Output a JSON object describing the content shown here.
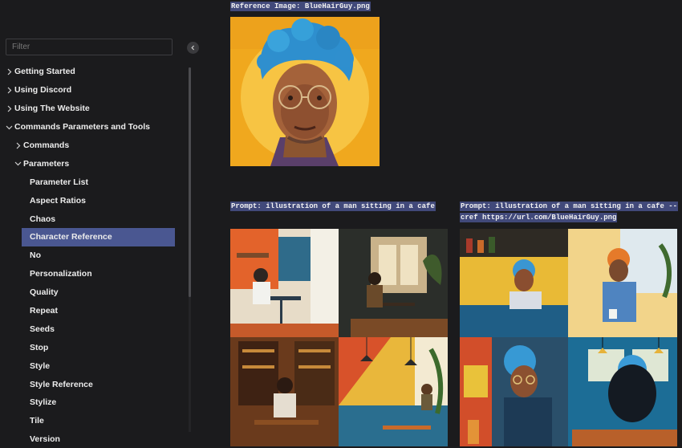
{
  "sidebar": {
    "filter_placeholder": "Filter",
    "items": [
      {
        "label": "Getting Started",
        "level": 0,
        "chevron": "right"
      },
      {
        "label": "Using Discord",
        "level": 0,
        "chevron": "right"
      },
      {
        "label": "Using The Website",
        "level": 0,
        "chevron": "right"
      },
      {
        "label": "Commands Parameters and Tools",
        "level": 0,
        "chevron": "down"
      },
      {
        "label": "Commands",
        "level": 1,
        "chevron": "right"
      },
      {
        "label": "Parameters",
        "level": 1,
        "chevron": "down"
      },
      {
        "label": "Parameter List",
        "level": 2
      },
      {
        "label": "Aspect Ratios",
        "level": 2
      },
      {
        "label": "Chaos",
        "level": 2
      },
      {
        "label": "Character Reference",
        "level": 2,
        "active": true
      },
      {
        "label": "No",
        "level": 2
      },
      {
        "label": "Personalization",
        "level": 2
      },
      {
        "label": "Quality",
        "level": 2
      },
      {
        "label": "Repeat",
        "level": 2
      },
      {
        "label": "Seeds",
        "level": 2
      },
      {
        "label": "Stop",
        "level": 2
      },
      {
        "label": "Style",
        "level": 2
      },
      {
        "label": "Style Reference",
        "level": 2
      },
      {
        "label": "Stylize",
        "level": 2
      },
      {
        "label": "Tile",
        "level": 2
      },
      {
        "label": "Version",
        "level": 2
      }
    ]
  },
  "main": {
    "reference_caption": "Reference Image: BlueHairGuy.png",
    "prompt_left_caption": "Prompt: illustration of a man sitting in a cafe",
    "prompt_right_line1": "Prompt: illustration of a man sitting in a cafe --",
    "prompt_right_line2": "cref https://url.com/BlueHairGuy.png"
  },
  "icons": {
    "collapse": "chevron-left-icon",
    "expand_collapsed": "chevron-right-icon",
    "expand_open": "chevron-down-icon"
  },
  "colors": {
    "background": "#1b1b1d",
    "active_item": "#4a5791",
    "caption_highlight": "#41497a",
    "portrait_yellow": "#f2b224",
    "hair_blue": "#2f8fd0"
  }
}
